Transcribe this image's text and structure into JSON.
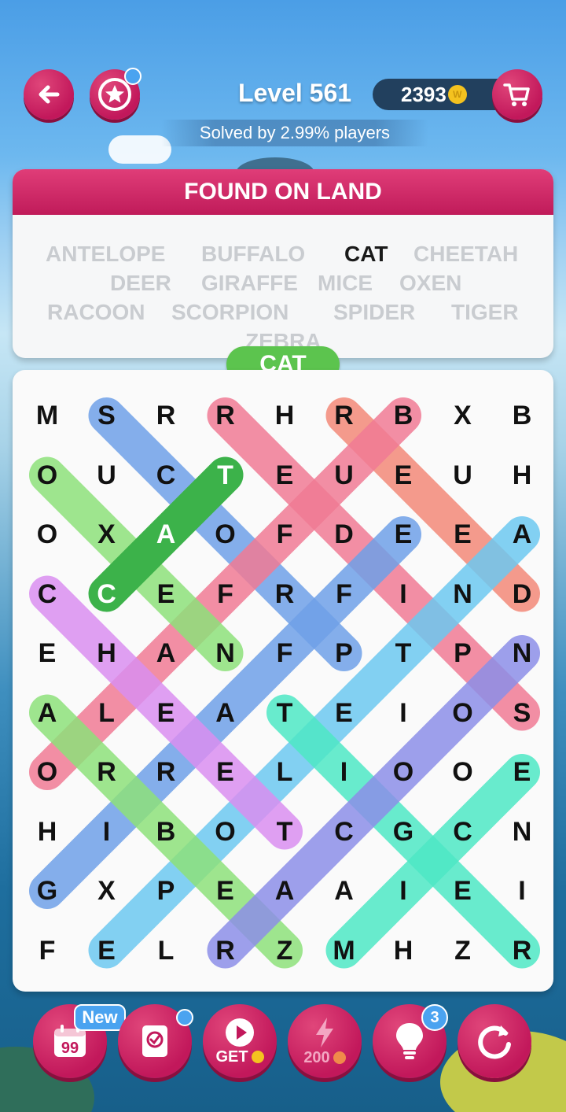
{
  "header": {
    "level": "Level 561",
    "coins": "2393",
    "coin_symbol": "W",
    "solved_text": "Solved by 2.99% players"
  },
  "panel": {
    "title": "FOUND ON LAND",
    "words": [
      {
        "text": "ANTELOPE",
        "found": true
      },
      {
        "text": "BUFFALO",
        "found": true
      },
      {
        "text": "CAT",
        "found": false
      },
      {
        "text": "CHEETAH",
        "found": true
      },
      {
        "text": "DEER",
        "found": true
      },
      {
        "text": "GIRAFFE",
        "found": true
      },
      {
        "text": "MICE",
        "found": true
      },
      {
        "text": "OXEN",
        "found": true
      },
      {
        "text": "RACOON",
        "found": true
      },
      {
        "text": "SCORPION",
        "found": true
      },
      {
        "text": "SPIDER",
        "found": true
      },
      {
        "text": "TIGER",
        "found": true
      },
      {
        "text": "ZEBRA",
        "found": true
      }
    ]
  },
  "current_word": "CAT",
  "grid": [
    [
      "M",
      "S",
      "R",
      "R",
      "H",
      "R",
      "B",
      "X",
      "B"
    ],
    [
      "O",
      "U",
      "C",
      "T",
      "E",
      "U",
      "E",
      "U",
      "H"
    ],
    [
      "O",
      "X",
      "A",
      "O",
      "F",
      "D",
      "E",
      "E",
      "A"
    ],
    [
      "C",
      "C",
      "E",
      "F",
      "R",
      "F",
      "I",
      "N",
      "D"
    ],
    [
      "E",
      "H",
      "A",
      "N",
      "F",
      "P",
      "T",
      "P",
      "N"
    ],
    [
      "A",
      "L",
      "E",
      "A",
      "T",
      "E",
      "I",
      "O",
      "S"
    ],
    [
      "O",
      "R",
      "R",
      "E",
      "L",
      "I",
      "O",
      "O",
      "E"
    ],
    [
      "H",
      "I",
      "B",
      "O",
      "T",
      "C",
      "G",
      "C",
      "N"
    ],
    [
      "G",
      "X",
      "P",
      "E",
      "A",
      "A",
      "I",
      "E",
      "I"
    ],
    [
      "F",
      "E",
      "L",
      "R",
      "Z",
      "M",
      "H",
      "Z",
      "R"
    ]
  ],
  "found_lines": [
    {
      "from": [
        0,
        1
      ],
      "to": [
        4,
        5
      ],
      "color": "#6fa0e8"
    },
    {
      "from": [
        0,
        3
      ],
      "to": [
        5,
        8
      ],
      "color": "#f07a94"
    },
    {
      "from": [
        0,
        5
      ],
      "to": [
        3,
        8
      ],
      "color": "#f28878"
    },
    {
      "from": [
        0,
        6
      ],
      "to": [
        6,
        0
      ],
      "color": "#f07a94"
    },
    {
      "from": [
        1,
        0
      ],
      "to": [
        4,
        3
      ],
      "color": "#8de07a"
    },
    {
      "from": [
        2,
        8
      ],
      "to": [
        9,
        1
      ],
      "color": "#6cc8f0"
    },
    {
      "from": [
        2,
        6
      ],
      "to": [
        8,
        0
      ],
      "color": "#6fa0e8"
    },
    {
      "from": [
        3,
        0
      ],
      "to": [
        7,
        4
      ],
      "color": "#d98ef0"
    },
    {
      "from": [
        5,
        0
      ],
      "to": [
        9,
        4
      ],
      "color": "#8de07a"
    },
    {
      "from": [
        5,
        4
      ],
      "to": [
        9,
        8
      ],
      "color": "#4ee8c4"
    },
    {
      "from": [
        4,
        8
      ],
      "to": [
        9,
        3
      ],
      "color": "#8c8ee8"
    },
    {
      "from": [
        6,
        8
      ],
      "to": [
        9,
        5
      ],
      "color": "#4ee8c4"
    },
    {
      "from": [
        1,
        3
      ],
      "to": [
        3,
        1
      ],
      "color": "#3cb24a"
    }
  ],
  "bottom_bar": {
    "new_badge": "New",
    "get_label": "GET",
    "energy_label": "200",
    "hint_count": "3"
  }
}
